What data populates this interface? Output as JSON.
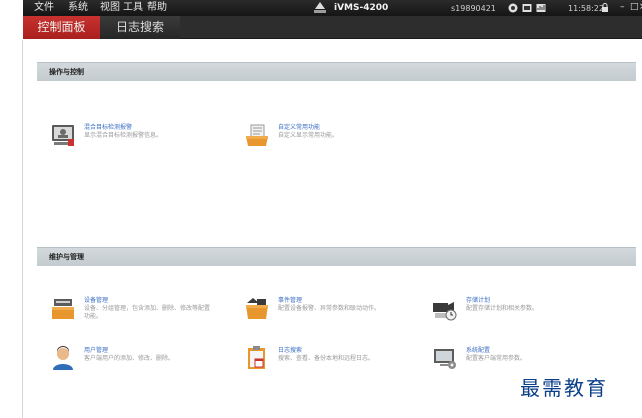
{
  "menu": {
    "file": "文件",
    "system": "系统",
    "view": "视图",
    "tools": "工具",
    "help": "帮助"
  },
  "app": {
    "title": "iVMS-4200",
    "user": "s19890421",
    "time": "11:58:22"
  },
  "window_controls": {
    "minimize": "–",
    "maximize": "□",
    "close": "×"
  },
  "tabs": [
    {
      "label": "控制面板",
      "active": true
    },
    {
      "label": "日志搜索",
      "active": false
    }
  ],
  "sections": {
    "operation": {
      "title": "操作与控制",
      "items": [
        {
          "title": "混合目标检测报警",
          "desc": "显示混合目标检测报警信息。",
          "icon": "alarm-monitor-icon"
        },
        {
          "title": "自定义常用功能",
          "desc": "自定义显示常用功能。",
          "icon": "custom-function-icon"
        }
      ]
    },
    "maintenance": {
      "title": "维护与管理",
      "items": [
        {
          "title": "设备管理",
          "desc": "设备、分组管理，包含添加、删除、修改等配置功能。",
          "icon": "device-management-icon"
        },
        {
          "title": "事件管理",
          "desc": "配置设备报警、异常参数和联动动作。",
          "icon": "event-management-icon"
        },
        {
          "title": "存储计划",
          "desc": "配置存储计划和相关参数。",
          "icon": "storage-schedule-icon"
        },
        {
          "title": "用户管理",
          "desc": "客户端用户的添加、修改、删除。",
          "icon": "user-management-icon"
        },
        {
          "title": "日志搜索",
          "desc": "搜索、查看、备份本地和远程日志。",
          "icon": "log-search-icon"
        },
        {
          "title": "系统配置",
          "desc": "配置客户端常用参数。",
          "icon": "system-config-icon"
        }
      ]
    }
  },
  "watermark": "最需教育",
  "colors": {
    "accent_red": "#b52724",
    "link_blue": "#3c6fc4",
    "titlebar": "#1e1e1e",
    "section_bar": "#cbd2d6"
  }
}
